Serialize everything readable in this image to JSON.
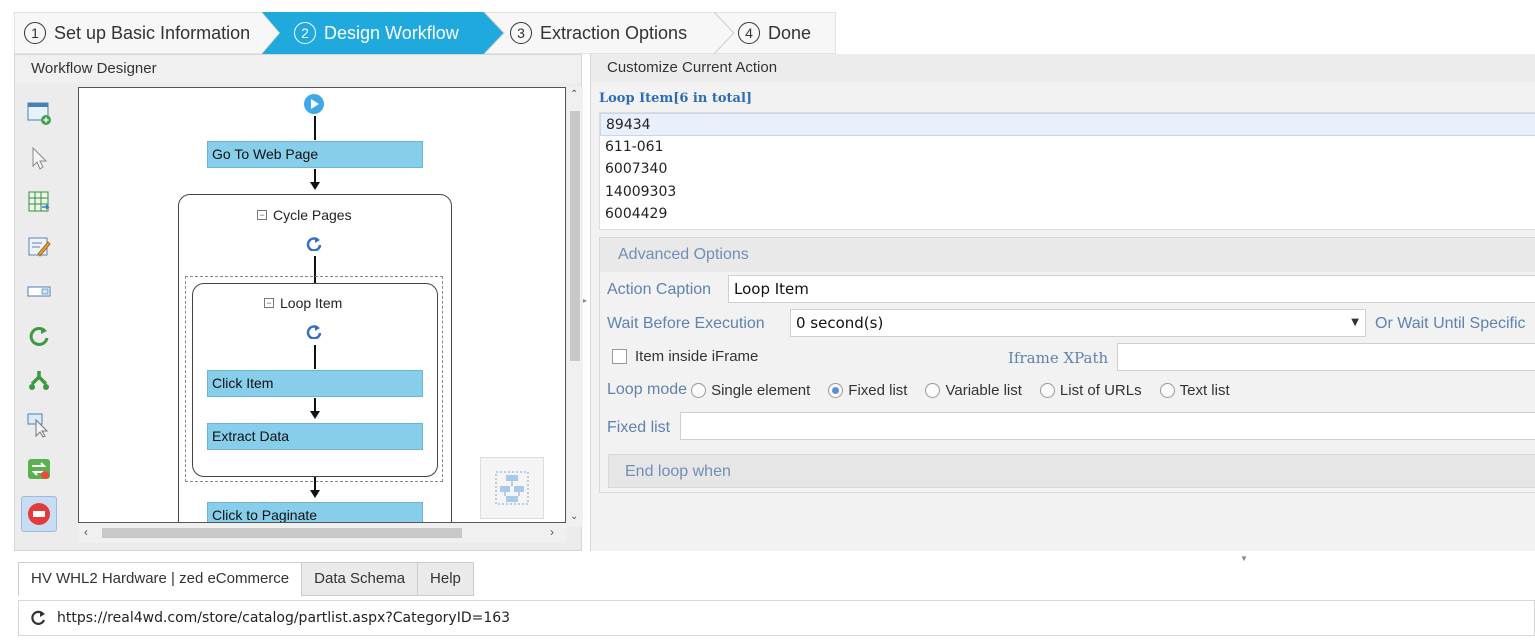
{
  "wizard": {
    "steps": [
      {
        "num": "1",
        "label": "Set up Basic Information",
        "active": false
      },
      {
        "num": "2",
        "label": "Design Workflow",
        "active": true
      },
      {
        "num": "3",
        "label": "Extraction Options",
        "active": false
      },
      {
        "num": "4",
        "label": "Done",
        "active": false
      }
    ]
  },
  "designer": {
    "title": "Workflow Designer",
    "tools": [
      "new-page-icon",
      "pointer-icon",
      "extract-table-icon",
      "edit-form-icon",
      "input-field-icon",
      "loop-icon",
      "branch-icon",
      "click-select-icon",
      "swap-icon",
      "stop-icon"
    ],
    "nodes": {
      "go_to_web_page": "Go To Web Page",
      "cycle_pages": "Cycle Pages",
      "loop_item": "Loop Item",
      "click_item": "Click Item",
      "extract_data": "Extract Data",
      "click_to_paginate": "Click to Paginate"
    }
  },
  "action": {
    "title": "Customize Current Action",
    "loop_item_title": "Loop Item[6 in total]",
    "items": [
      "89434",
      "611-061",
      "6007340",
      "14009303",
      "6004429"
    ],
    "advanced_header": "Advanced Options",
    "caption_label": "Action Caption",
    "caption_value": "Loop Item",
    "wait_label": "Wait Before Execution",
    "wait_value": "0 second(s)",
    "wait_until_label": "Or Wait Until Specific",
    "iframe_label": "Item inside iFrame",
    "iframe_xpath_label": "Iframe XPath",
    "loop_mode_label": "Loop mode",
    "loop_modes": [
      "Single element",
      "Fixed list",
      "Variable list",
      "List of URLs",
      "Text list"
    ],
    "loop_mode_selected": "Fixed list",
    "fixed_list_label": "Fixed list",
    "end_loop_label": "End loop when"
  },
  "bottom": {
    "tabs": [
      "HV WHL2 Hardware | zed eCommerce",
      "Data Schema",
      "Help"
    ],
    "url": "https://real4wd.com/store/catalog/partlist.aspx?CategoryID=163"
  },
  "colors": {
    "active_step": "#1fa9dd",
    "node_fill": "#87ceeb",
    "label_blue": "#5f82b0"
  }
}
